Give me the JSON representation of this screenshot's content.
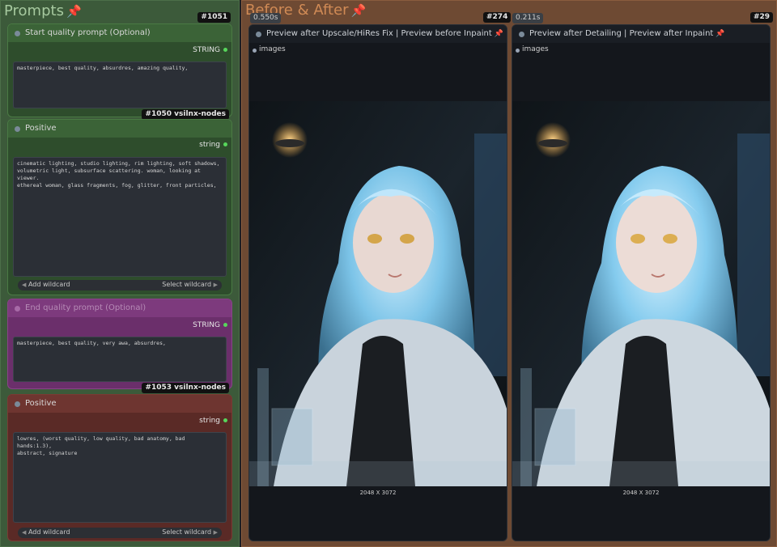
{
  "prompts_group": {
    "title": "Prompts",
    "badge": "#1051",
    "nodes": {
      "start_quality": {
        "title": "Start quality prompt (Optional)",
        "output": "STRING",
        "text": "masterpiece, best quality, absurdres, amazing quality,",
        "badge": "#1050 vsilnx-nodes"
      },
      "positive": {
        "title": "Positive",
        "output": "string",
        "text": "cinematic lighting, studio lighting, rim lighting, soft shadows,\nvolumetric light, subsurface scattering. woman, looking at viewer.\nethereal woman, glass fragments, fog, glitter, front particles,",
        "add_wildcard": "Add wildcard",
        "select_wildcard": "Select wildcard"
      },
      "end_quality": {
        "title": "End quality prompt (Optional)",
        "output": "STRING",
        "text": "masterpiece, best quality, very awa, absurdres,",
        "badge": "#1053 vsilnx-nodes"
      },
      "negative": {
        "title": "Positive",
        "output": "string",
        "text": "lowres, (worst quality, low quality, bad anatomy, bad hands:1.3),\nabstract, signature",
        "add_wildcard": "Add wildcard",
        "select_wildcard": "Select wildcard"
      }
    }
  },
  "before_after_group": {
    "title": "Before & After",
    "previews": [
      {
        "timing": "0.550s",
        "badge": "#274",
        "title": "Preview after Upscale/HiRes Fix | Preview before Inpaint",
        "output": "images",
        "dimensions": "2048 X 3072"
      },
      {
        "timing": "0.211s",
        "badge": "#29",
        "title": "Preview after Detailing | Preview after Inpaint",
        "output": "images",
        "dimensions": "2048 X 3072"
      }
    ]
  },
  "icons": {
    "pin": "pin-icon",
    "left_arrow": "triangle-left-icon",
    "right_arrow": "triangle-right-icon"
  },
  "colors": {
    "prompts_group_bg": "#3c5a3a",
    "before_after_group_bg": "#6e4a33",
    "output_dot": "#57d65b",
    "pin": "#e0484d"
  }
}
